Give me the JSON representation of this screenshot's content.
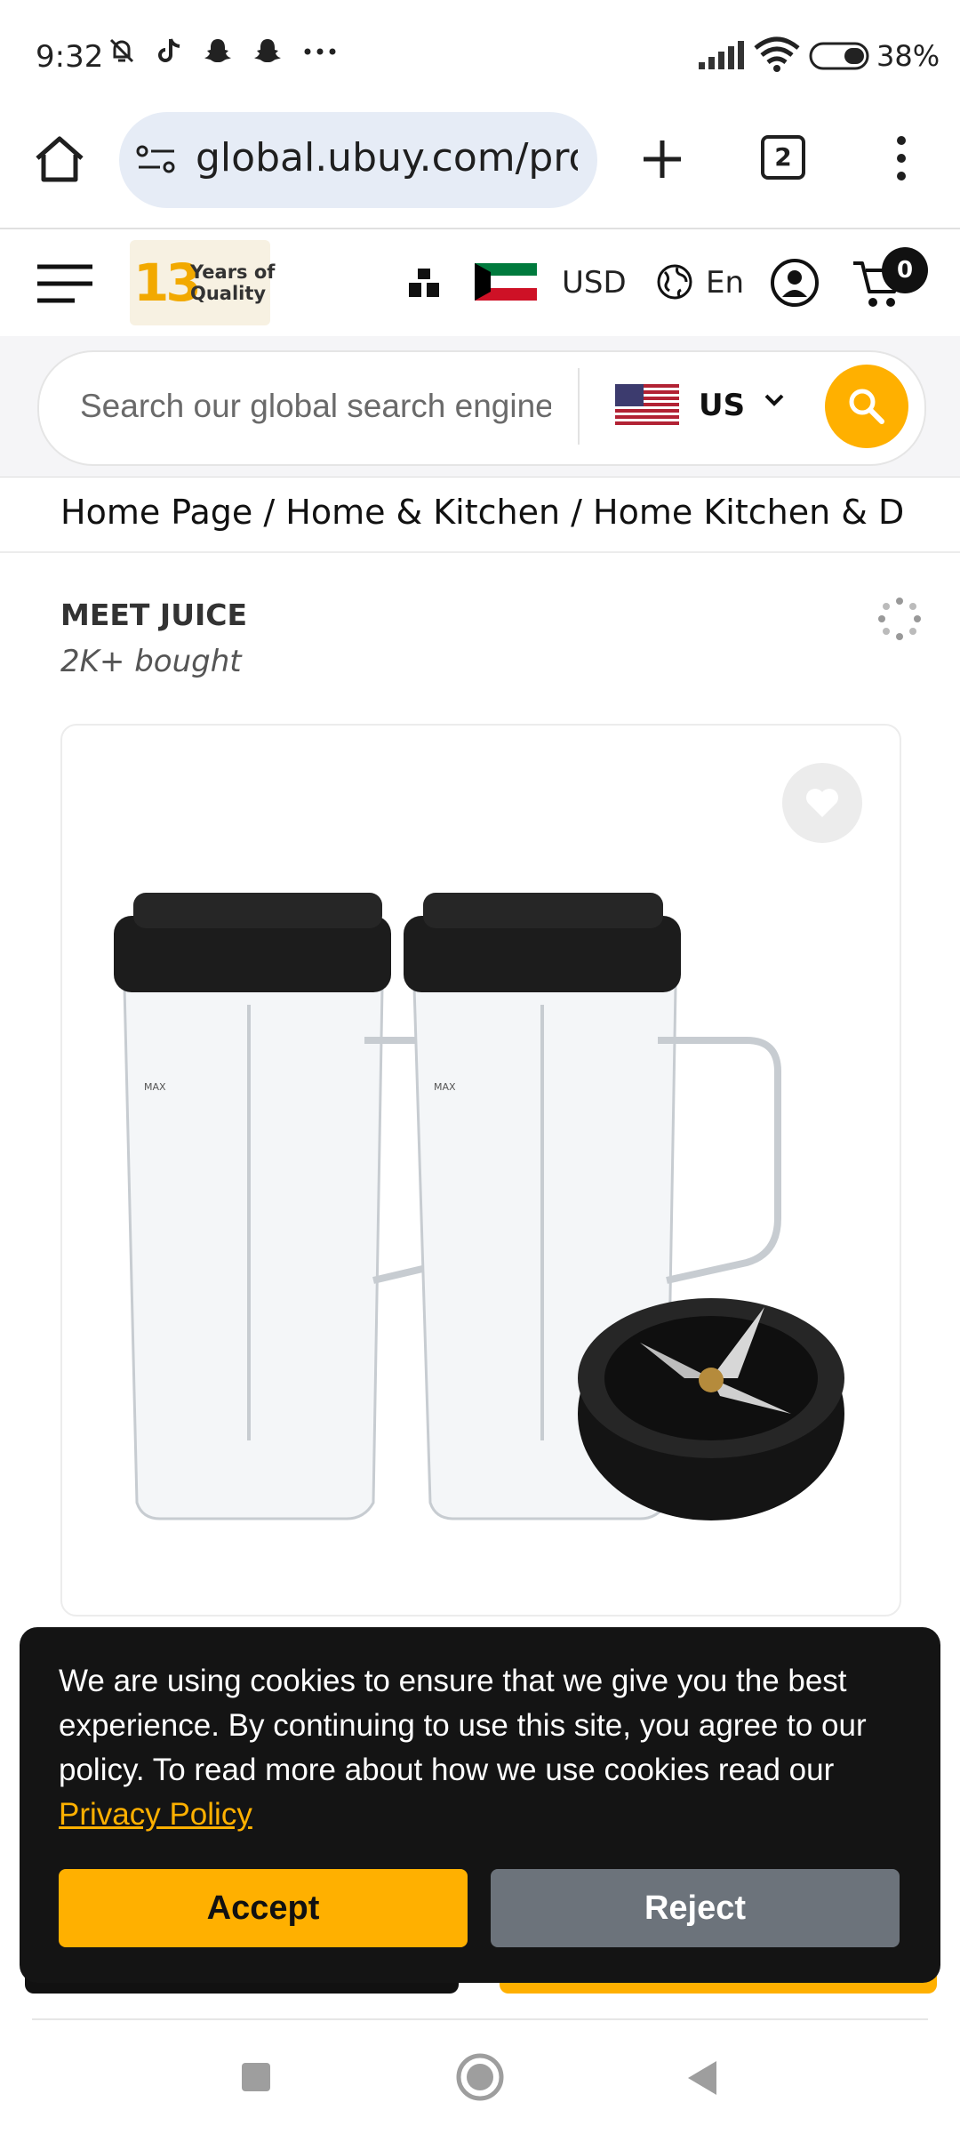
{
  "status_bar": {
    "time": "9:32",
    "battery": "38%",
    "icons_left": [
      "muted-bell-icon",
      "tiktok-icon",
      "snapchat-icon",
      "snapchat-icon",
      "more-dots-icon"
    ],
    "icons_right": [
      "signal-icon",
      "wifi-icon",
      "battery-icon"
    ]
  },
  "browser": {
    "url": "global.ubuy.com/products/",
    "tab_count": "2",
    "icons": [
      "home-icon",
      "site-settings-icon",
      "new-tab-icon",
      "tabs-icon",
      "more-vert-icon"
    ]
  },
  "header": {
    "logo_number": "13",
    "logo_line1": "Years of",
    "logo_line2": "Quality",
    "currency": "USD",
    "language": "En",
    "cart_count": "0",
    "icons": [
      "menu-icon",
      "store-icon",
      "kuwait-flag-icon",
      "globe-icon",
      "user-icon",
      "cart-icon"
    ]
  },
  "search": {
    "placeholder": "Search our global search engine",
    "country": "US",
    "icons": [
      "us-flag-icon",
      "chevron-down-icon",
      "search-icon"
    ]
  },
  "breadcrumb": {
    "text": "Home Page / Home & Kitchen / Home Kitchen & Di…"
  },
  "product": {
    "brand": "MEET JUICE",
    "bought": "2K+ bought",
    "image_desc_icons": [
      "share-icon",
      "heart-icon"
    ],
    "cup_label": "MAX"
  },
  "cookie_banner": {
    "text": "We are using cookies to ensure that we give you the best experience. By continuing to use this site, you agree to our policy. To read more about how we use cookies read our",
    "link_label": "Privacy Policy",
    "accept_label": "Accept",
    "reject_label": "Reject"
  },
  "colors": {
    "accent": "#ffb000",
    "dark": "#141414",
    "reject": "#6c737b",
    "url_pill": "#e6ecf6"
  }
}
